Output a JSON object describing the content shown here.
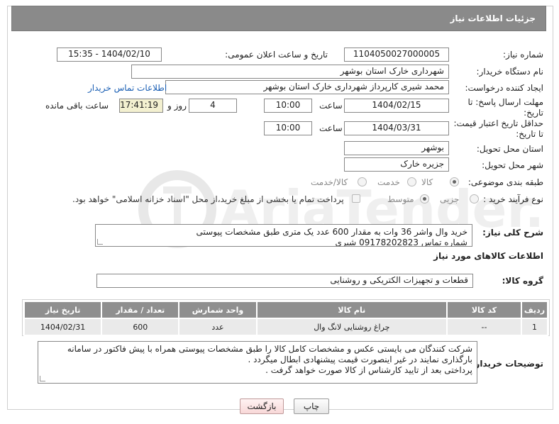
{
  "header": {
    "title": "جزئیات اطلاعات نیاز"
  },
  "form": {
    "need_number_label": "شماره نیاز:",
    "need_number": "1104050027000005",
    "announce_label": "تاریخ و ساعت اعلان عمومی:",
    "announce_value": "1404/02/10 - 15:35",
    "buyer_org_label": "نام دستگاه خریدار:",
    "buyer_org": "شهرداری خارک استان بوشهر",
    "requester_label": "ایجاد کننده درخواست:",
    "requester": "محمد شیری کارپرداز شهرداری خارک استان بوشهر",
    "contact_link": "اطلاعات تماس خریدار",
    "reply_deadline_label_1": "مهلت ارسال پاسخ: تا",
    "reply_deadline_label_2": "تاریخ:",
    "reply_date": "1404/02/15",
    "time_label": "ساعت",
    "reply_time": "10:00",
    "days_value": "4",
    "days_label": "روز و",
    "remaining_time": "17:41:19",
    "remaining_label": "ساعت باقی مانده",
    "price_validity_label_1": "حداقل تاریخ اعتبار قیمت:",
    "price_validity_label_2": "تا تاریخ:",
    "validity_date": "1404/03/31",
    "validity_time": "10:00",
    "province_label": "استان محل تحویل:",
    "province": "بوشهر",
    "city_label": "شهر محل تحویل:",
    "city": "جزیره خارک",
    "category_label": "طبقه بندی موضوعی:",
    "category_options": [
      "کالا",
      "خدمت",
      "کالا/خدمت"
    ],
    "category_selected": "کالا",
    "process_label": "نوع فرآیند خرید :",
    "process_options": [
      "جزیی",
      "متوسط"
    ],
    "process_selected": "متوسط",
    "payment_note": "پرداخت تمام یا بخشی از مبلغ خرید،از محل \"اسناد خزانه اسلامی\" خواهد بود."
  },
  "description": {
    "label": "شرح کلی نیاز:",
    "line1": "خرید وال واشر 36 وات به مقدار 600 عدد یک متری طبق مشخصات پیوستی",
    "line2": "شماره تماس 09178202823 شیری"
  },
  "goods": {
    "section_title": "اطلاعات کالاهای مورد نیاز",
    "group_label": "گروه کالا:",
    "group_value": "قطعات و تجهیزات الکتریکی و روشنایی",
    "columns": [
      "ردیف",
      "کد کالا",
      "نام کالا",
      "واحد شمارش",
      "تعداد / مقدار",
      "تاریخ نیاز"
    ],
    "rows": [
      {
        "row": "1",
        "code": "--",
        "name": "چراغ روشنایی لانگ وال",
        "unit": "عدد",
        "qty": "600",
        "date": "1404/02/31"
      }
    ]
  },
  "buyer_notes": {
    "label": "توضیحات خریدار:",
    "line1": "شرکت کنندگان می بایستی عکس و مشخصات کامل کالا را طبق مشخصات پیوستی همراه با پیش فاکتور در سامانه",
    "line2": "بارگذاری نمایند در غیر اینصورت قیمت پیشنهادی ابطال میگردد .",
    "line3": "پرداختی بعد از تایید کارشناس از کالا صورت خواهد گرفت ."
  },
  "buttons": {
    "print": "چاپ",
    "back": "بازگشت"
  },
  "watermark": "AriaTender.neT",
  "colors": {
    "header_bg": "#8a8a8a",
    "table_header_bg": "#8f8f8f",
    "link": "#1a5fb4",
    "back_button": "#f8d8d8"
  }
}
